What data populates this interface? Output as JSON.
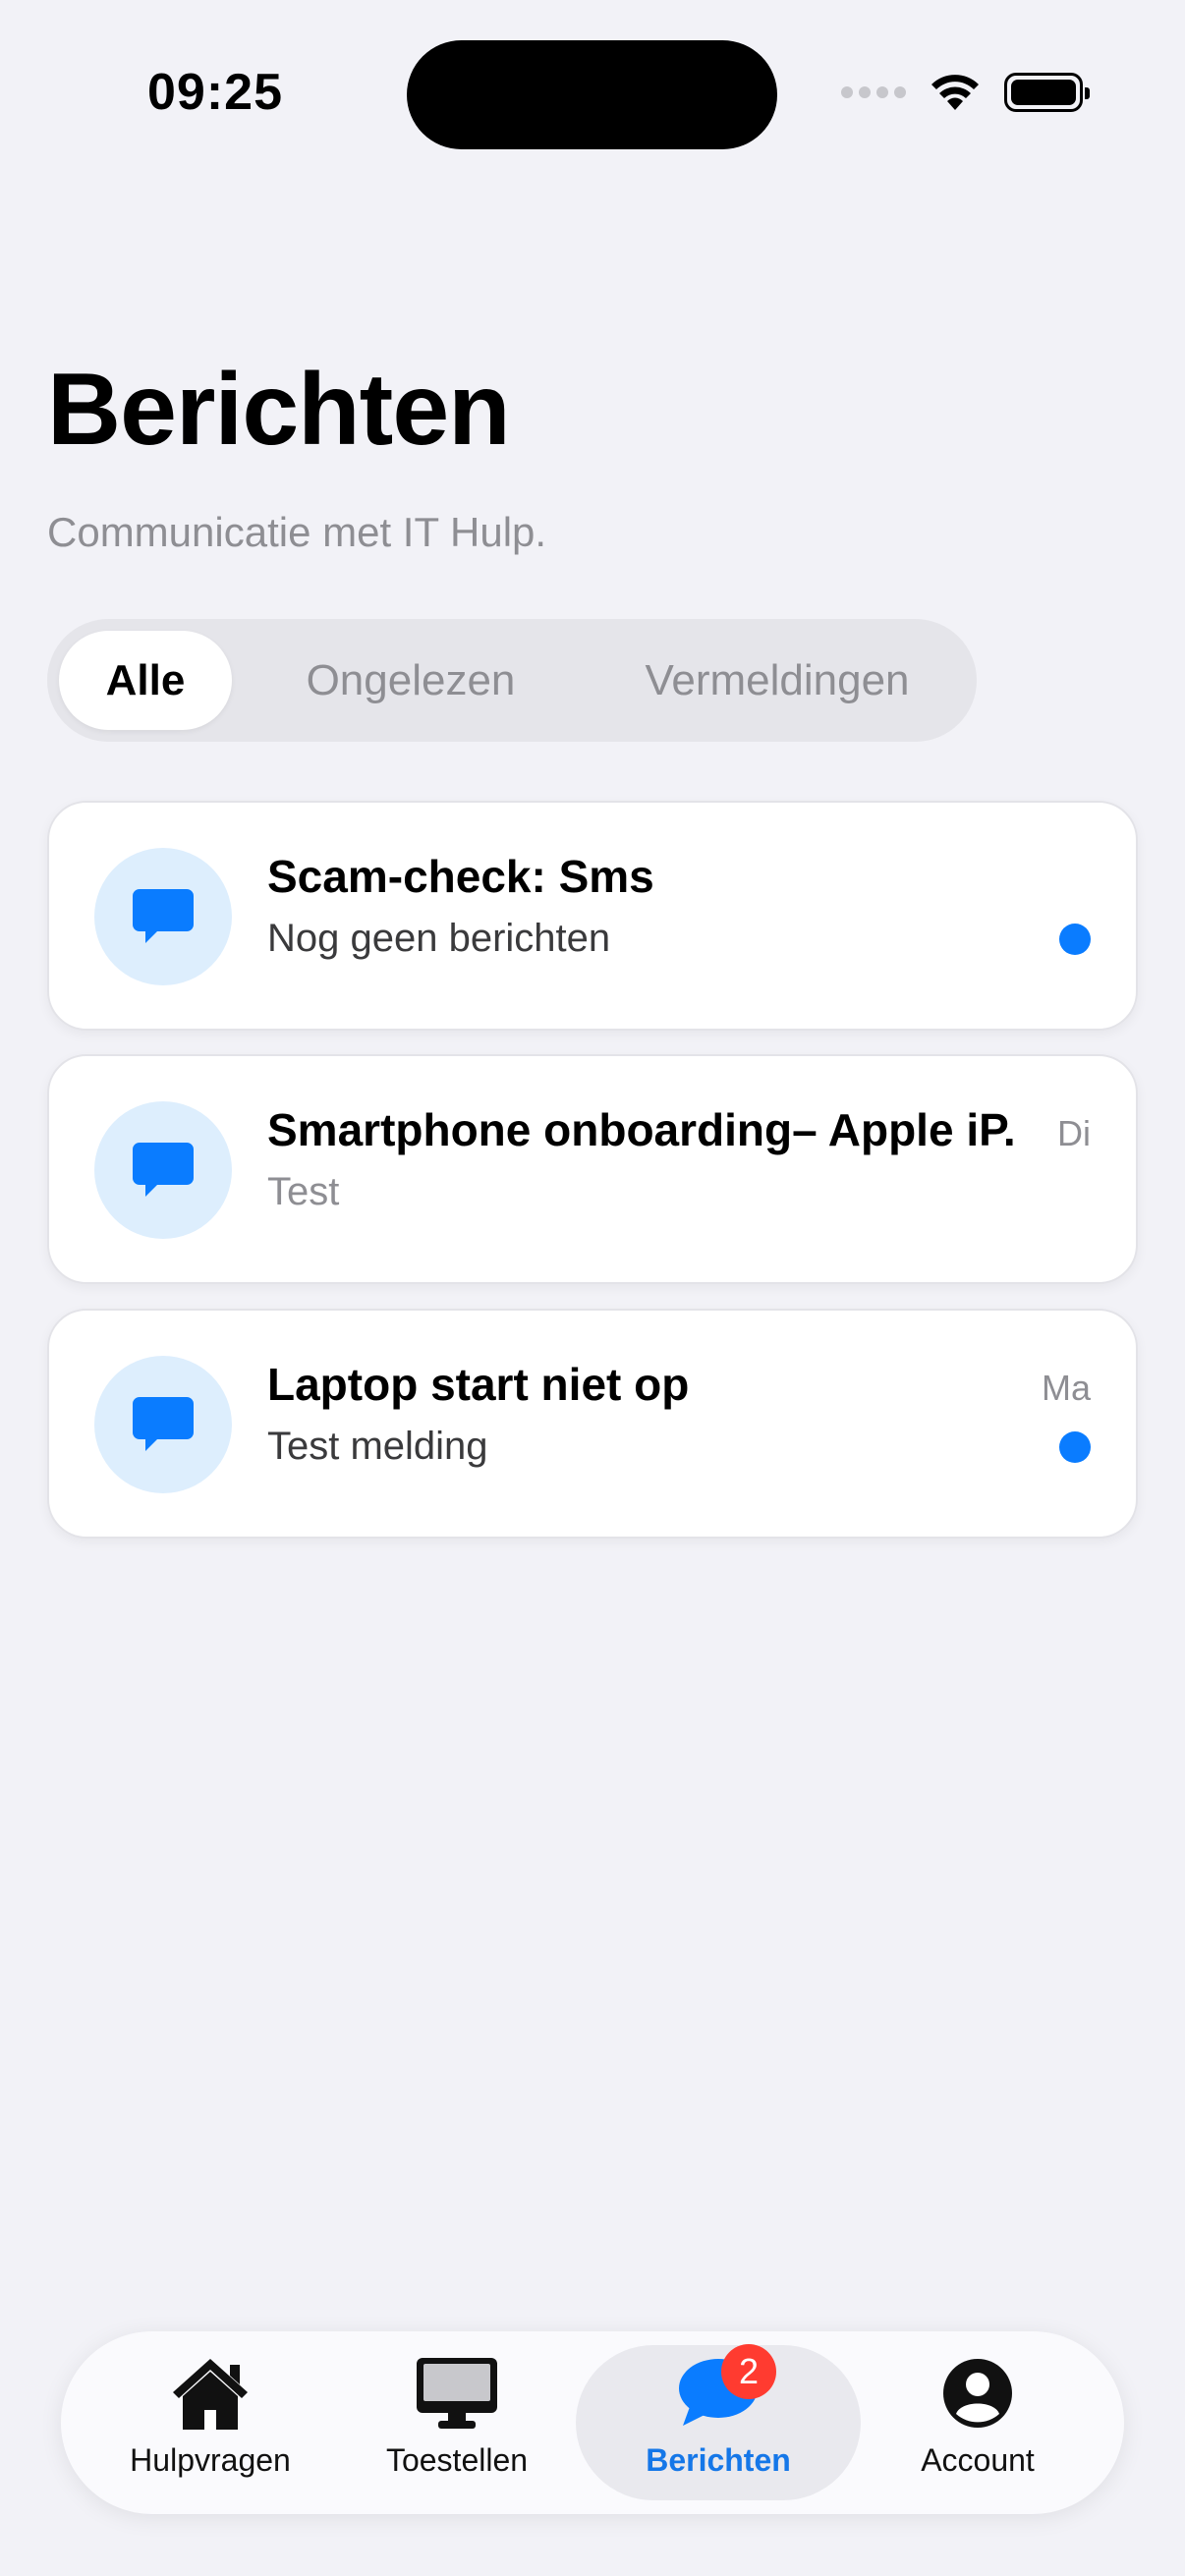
{
  "status_bar": {
    "time": "09:25"
  },
  "header": {
    "title": "Berichten",
    "subtitle": "Communicatie met IT Hulp."
  },
  "filter_tabs": {
    "items": [
      "Alle",
      "Ongelezen",
      "Vermeldingen"
    ],
    "selected": "Alle"
  },
  "messages": [
    {
      "title": "Scam-check: Sms",
      "preview": "Nog geen berichten",
      "day": "",
      "unread": true,
      "icon": "chat-bubble-icon"
    },
    {
      "title": "Smartphone onboarding– Apple iP...",
      "preview": "Test",
      "day": "Di",
      "unread": false,
      "icon": "chat-bubble-icon"
    },
    {
      "title": "Laptop start niet op",
      "preview": "Test melding",
      "day": "Ma",
      "unread": true,
      "icon": "chat-bubble-icon"
    }
  ],
  "tab_bar": {
    "items": [
      {
        "label": "Hulpvragen",
        "icon": "house-icon"
      },
      {
        "label": "Toestellen",
        "icon": "desktop-icon"
      },
      {
        "label": "Berichten",
        "icon": "chat-bubble-icon",
        "badge": "2"
      },
      {
        "label": "Account",
        "icon": "person-circle-icon"
      }
    ],
    "active": "Berichten"
  },
  "colors": {
    "accent": "#0a7cff",
    "background": "#f2f2f7",
    "badge": "#ff3b30",
    "avatar_bg": "#ddeefd"
  }
}
